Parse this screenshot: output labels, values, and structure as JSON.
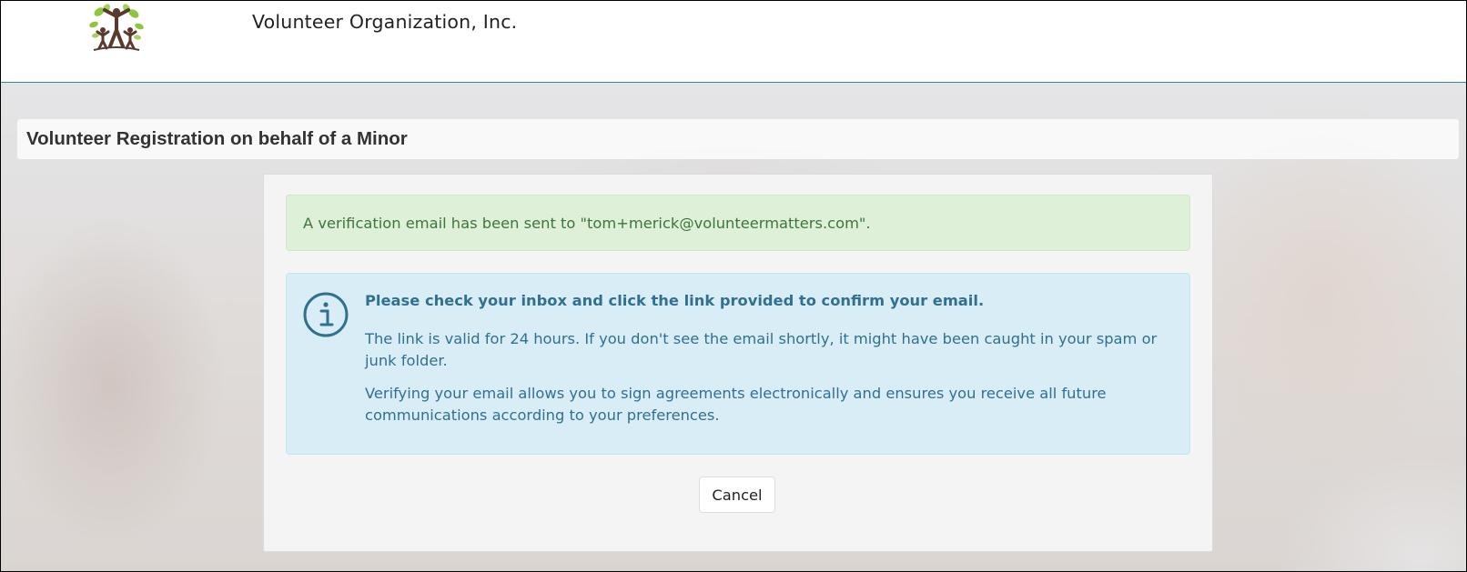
{
  "header": {
    "org_name": "Volunteer Organization, Inc.",
    "logo_icon": "volunteer-family-tree-logo"
  },
  "page": {
    "title": "Volunteer Registration on behalf of a Minor"
  },
  "success_alert": {
    "message": "A verification email has been sent to \"tom+merick@volunteermatters.com\".",
    "color": "#3c763d",
    "background": "#dff0d8"
  },
  "info_alert": {
    "icon": "info-circle-icon",
    "heading": "Please check your inbox and click the link provided to confirm your email.",
    "paragraph1": "The link is valid for 24 hours. If you don't see the email shortly, it might have been caught in your spam or junk folder.",
    "paragraph2": "Verifying your email allows you to sign agreements electronically and ensures you receive all future communications according to your preferences.",
    "color": "#31708f",
    "background": "#d9edf7"
  },
  "actions": {
    "cancel_label": "Cancel"
  }
}
